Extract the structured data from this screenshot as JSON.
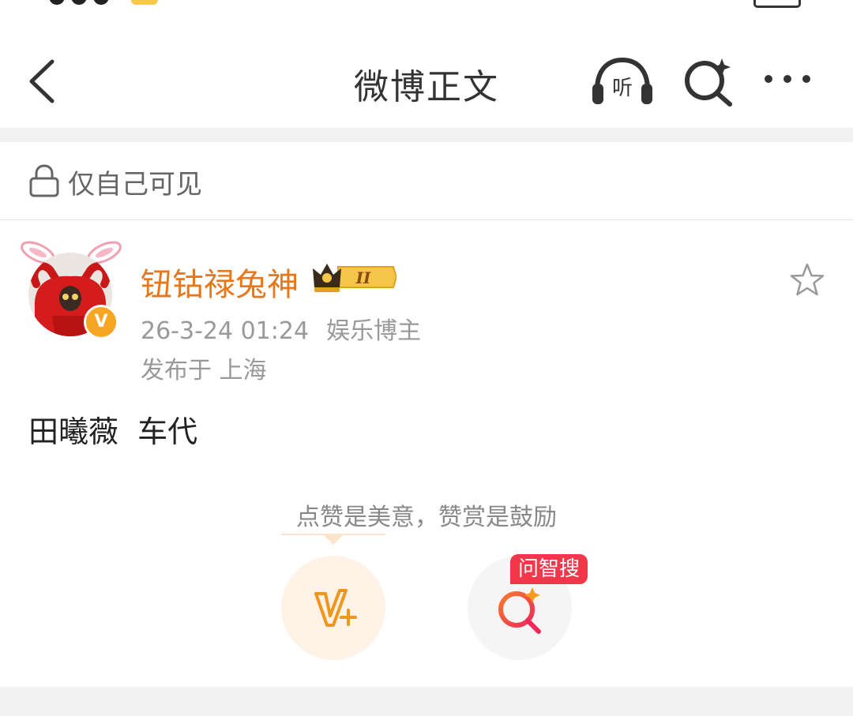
{
  "nav": {
    "title": "微博正文",
    "listen_label": "听"
  },
  "post": {
    "visibility": "仅自己可见",
    "author": "钮钴禄兔神",
    "timestamp": "26-3-24 01:24",
    "role": "娱乐博主",
    "location": "发布于 上海",
    "text": "田曦薇  车代",
    "verified_badge": "V",
    "crown_level": "II"
  },
  "reward": {
    "prompt": "点赞是美意，赞赏是鼓励",
    "ask_tag": "问智搜"
  },
  "colors": {
    "accent_orange": "#e8761a",
    "ask_red": "#f2374a"
  }
}
